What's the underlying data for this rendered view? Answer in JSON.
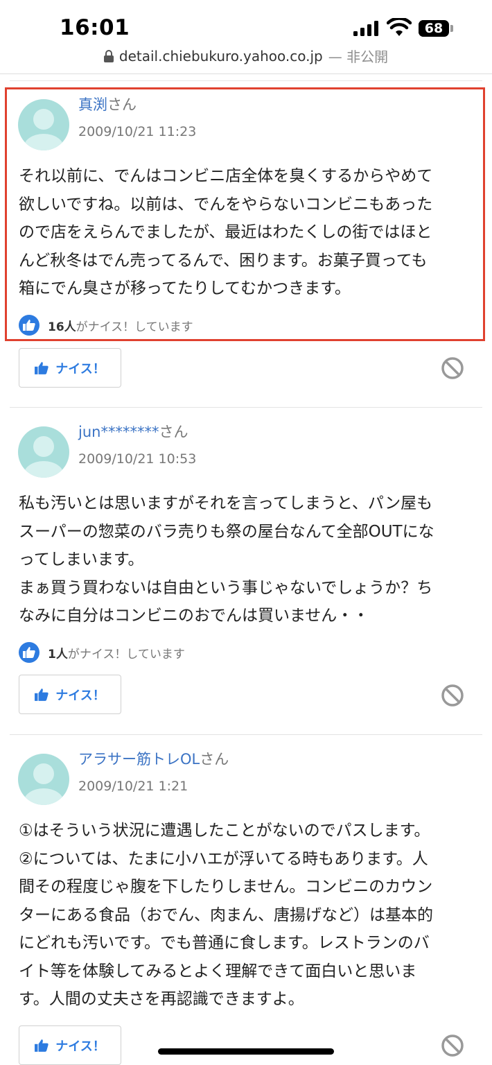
{
  "status_bar": {
    "time": "16:01",
    "battery": "68"
  },
  "browser": {
    "domain": "detail.chiebukuro.yahoo.co.jp",
    "suffix": "— 非公開"
  },
  "answers": [
    {
      "user": "真渕",
      "suffix": "さん",
      "date": "2009/10/21 11:23",
      "body": "それ以前に、でんはコンビニ店全体を臭くするからやめて\n欲しいですね。以前は、でんをやらないコンビニもあった\nので店をえらんでましたが、最近はわたくしの街ではほと\nんど秋冬はでん売ってるんで、困ります。お菓子買っても\n箱にでん臭さが移ってたりしてむかつきます。",
      "likes_count": "16人",
      "likes_suffix": "がナイス！しています",
      "nice_label": "ナイス！"
    },
    {
      "user": "jun********",
      "suffix": "さん",
      "date": "2009/10/21 10:53",
      "body": "私も汚いとは思いますがそれを言ってしまうと、パン屋も\nスーパーの惣菜のバラ売りも祭の屋台なんて全部OUTにな\nってしまいます。\nまぁ買う買わないは自由という事じゃないでしょうか？ち\nなみに自分はコンビニのおでんは買いません・・",
      "likes_count": "1人",
      "likes_suffix": "がナイス！しています",
      "nice_label": "ナイス！"
    },
    {
      "user": "アラサー筋トレOL",
      "suffix": "さん",
      "date": "2009/10/21 1:21",
      "body": "①はそういう状況に遭遇したことがないのでパスします。\n②については、たまに小ハエが浮いてる時もあります。人\n間その程度じゃ腹を下したりしません。コンビニのカウン\nターにある食品（おでん、肉まん、唐揚げなど）は基本的\nにどれも汚いです。でも普通に食します。レストランのバ\nイト等を体験してみるとよく理解できて面白いと思いま\nす。人間の丈夫さを再認識できますよ。",
      "nice_label": "ナイス！"
    }
  ]
}
